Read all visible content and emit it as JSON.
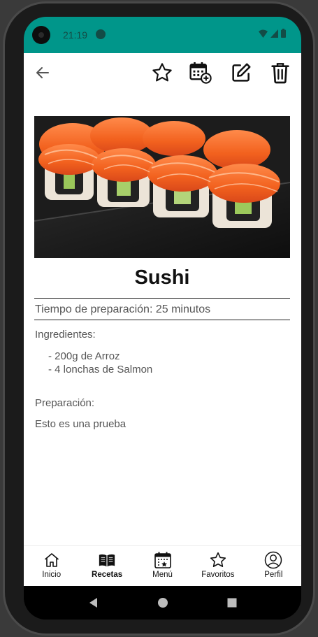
{
  "status_bar": {
    "time": "21:19",
    "bg_color": "#00968a"
  },
  "toolbar": {
    "back_icon": "arrow-left-icon",
    "actions": [
      {
        "name": "favorite",
        "icon": "star-outline-icon"
      },
      {
        "name": "add-to-calendar",
        "icon": "calendar-add-icon"
      },
      {
        "name": "edit",
        "icon": "edit-icon"
      },
      {
        "name": "delete",
        "icon": "trash-icon"
      }
    ]
  },
  "recipe": {
    "image": "sushi-photo",
    "title": "Sushi",
    "prep_time": "Tiempo de preparación: 25 minutos",
    "ingredients_label": "Ingredientes:",
    "ingredients": [
      "- 200g de  Arroz",
      "- 4 lonchas de Salmon"
    ],
    "preparation_label": "Preparación:",
    "preparation_text": "Esto es una prueba"
  },
  "bottom_nav": {
    "items": [
      {
        "label": "Inicio",
        "icon": "home-icon",
        "active": false
      },
      {
        "label": "Recetas",
        "icon": "recipe-book-icon",
        "active": true
      },
      {
        "label": "Menú",
        "icon": "calendar-star-icon",
        "active": false
      },
      {
        "label": "Favoritos",
        "icon": "star-icon",
        "active": false
      },
      {
        "label": "Perfil",
        "icon": "profile-icon",
        "active": false
      }
    ]
  }
}
